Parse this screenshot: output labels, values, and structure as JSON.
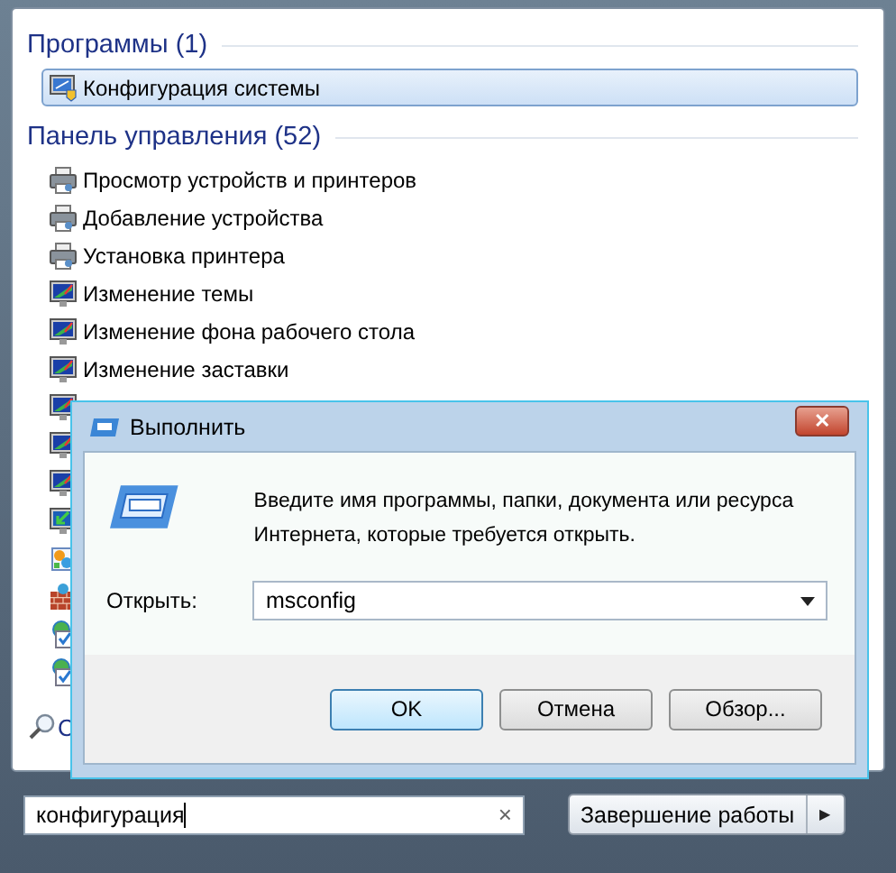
{
  "programs": {
    "heading": "Программы (1)",
    "items": [
      {
        "label": "Конфигурация системы",
        "kind": "monitor-shield",
        "selected": true
      }
    ]
  },
  "control_panel": {
    "heading": "Панель управления (52)",
    "items": [
      {
        "label": "Просмотр устройств и принтеров",
        "kind": "printer"
      },
      {
        "label": "Добавление устройства",
        "kind": "printer"
      },
      {
        "label": "Установка принтера",
        "kind": "printer"
      },
      {
        "label": "Изменение темы",
        "kind": "monitor"
      },
      {
        "label": "Изменение фона рабочего стола",
        "kind": "monitor"
      },
      {
        "label": "Изменение заставки",
        "kind": "monitor"
      },
      {
        "kind": "monitor"
      },
      {
        "kind": "monitor"
      },
      {
        "kind": "monitor"
      },
      {
        "kind": "monitor-arrow"
      },
      {
        "kind": "colorful"
      },
      {
        "kind": "brick"
      },
      {
        "kind": "globe-check"
      },
      {
        "kind": "globe-check"
      }
    ]
  },
  "see_more": {
    "label": "С"
  },
  "search": {
    "value": "конфигурация",
    "clear": "×"
  },
  "shutdown": {
    "label": "Завершение работы",
    "arrow": "▶"
  },
  "run_dialog": {
    "title": "Выполнить",
    "close": "✕",
    "prompt": "Введите имя программы, папки, документа или ресурса Интернета, которые требуется открыть.",
    "open_label": "Открыть:",
    "value": "msconfig",
    "buttons": [
      {
        "label": "OK",
        "default": true
      },
      {
        "label": "Отмена",
        "default": false
      },
      {
        "label": "Обзор...",
        "default": false
      }
    ]
  }
}
